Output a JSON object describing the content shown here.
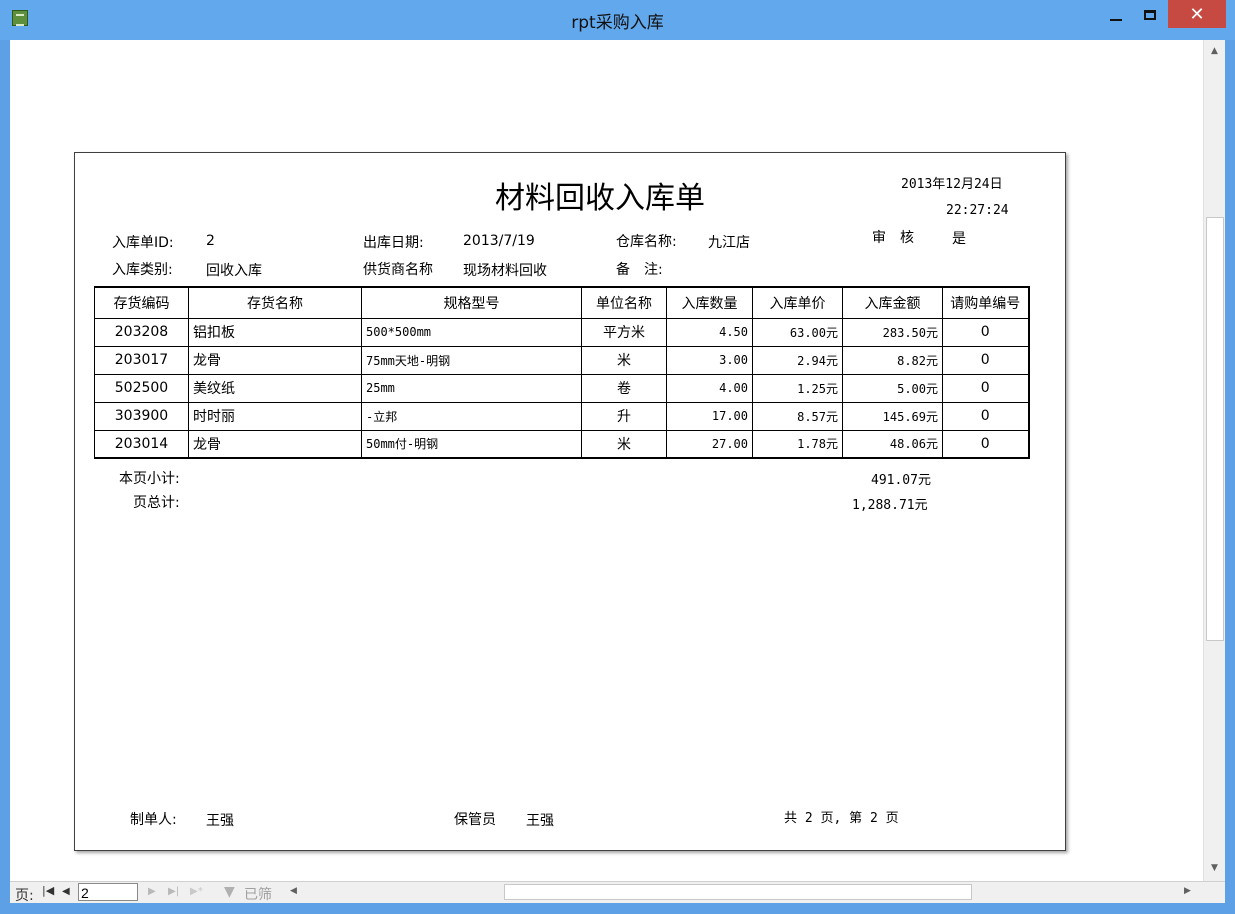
{
  "window": {
    "title": "rpt采购入库",
    "close_glyph": "✕"
  },
  "report": {
    "title": "材料回收入库单",
    "date": "2013年12月24日",
    "time": "22:27:24",
    "fields": {
      "id_label": "入库单ID:",
      "id_value": "2",
      "out_date_label": "出库日期:",
      "out_date_value": "2013/7/19",
      "warehouse_label": "仓库名称:",
      "warehouse_value": "九江店",
      "audit_label": "审　核",
      "audit_value": "是",
      "type_label": "入库类别:",
      "type_value": "回收入库",
      "supplier_label": "供货商名称",
      "supplier_value": "现场材料回收",
      "remark_label": "备　注:"
    },
    "columns": [
      "存货编码",
      "存货名称",
      "规格型号",
      "单位名称",
      "入库数量",
      "入库单价",
      "入库金额",
      "请购单编号"
    ],
    "rows": [
      [
        "203208",
        "铝扣板",
        "500*500mm",
        "平方米",
        "4.50",
        "63.00元",
        "283.50元",
        "0"
      ],
      [
        "203017",
        "龙骨",
        "75mm天地-明钢",
        "米",
        "3.00",
        "2.94元",
        "8.82元",
        "0"
      ],
      [
        "502500",
        "美纹纸",
        "25mm",
        "卷",
        "4.00",
        "1.25元",
        "5.00元",
        "0"
      ],
      [
        "303900",
        "时时丽",
        "-立邦",
        "升",
        "17.00",
        "8.57元",
        "145.69元",
        "0"
      ],
      [
        "203014",
        "龙骨",
        "50mm付-明钢",
        "米",
        "27.00",
        "1.78元",
        "48.06元",
        "0"
      ]
    ],
    "subtotal_label": "本页小计:",
    "subtotal_value": "491.07元",
    "total_label": "页总计:",
    "total_value": "1,288.71元",
    "maker_label": "制单人:",
    "maker_value": "王强",
    "keeper_label": "保管员",
    "keeper_value": "王强",
    "page_info": "共 2 页, 第 2 页"
  },
  "navbar": {
    "page_label": "页:",
    "page_value": "2",
    "filter_label": "已筛"
  }
}
